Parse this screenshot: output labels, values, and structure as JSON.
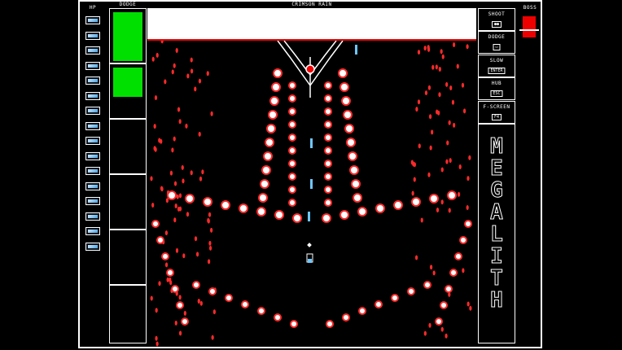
{
  "hud": {
    "hp_label": "HP",
    "dodge_label": "DODGE",
    "stage_title": "CRIMSON RAIN",
    "boss_label": "BOSS",
    "hp_cells": 16
  },
  "controls": [
    {
      "label": "SHOOT",
      "key": "●●"
    },
    {
      "label": "DODGE",
      "key": "▭"
    },
    {
      "label": "SLOW",
      "key": "ENTER"
    },
    {
      "label": "HUB",
      "key": "ESC"
    },
    {
      "label": "F-SCREEN",
      "key": "F4"
    }
  ],
  "logo_letters": [
    "M",
    "E",
    "G",
    "A",
    "L",
    "I",
    "T",
    "H"
  ],
  "colors": {
    "dodge_fill": "#00e000",
    "bullet": "#ff2a2a",
    "boss_red": "#e00000",
    "player": "#6ec6ff"
  }
}
